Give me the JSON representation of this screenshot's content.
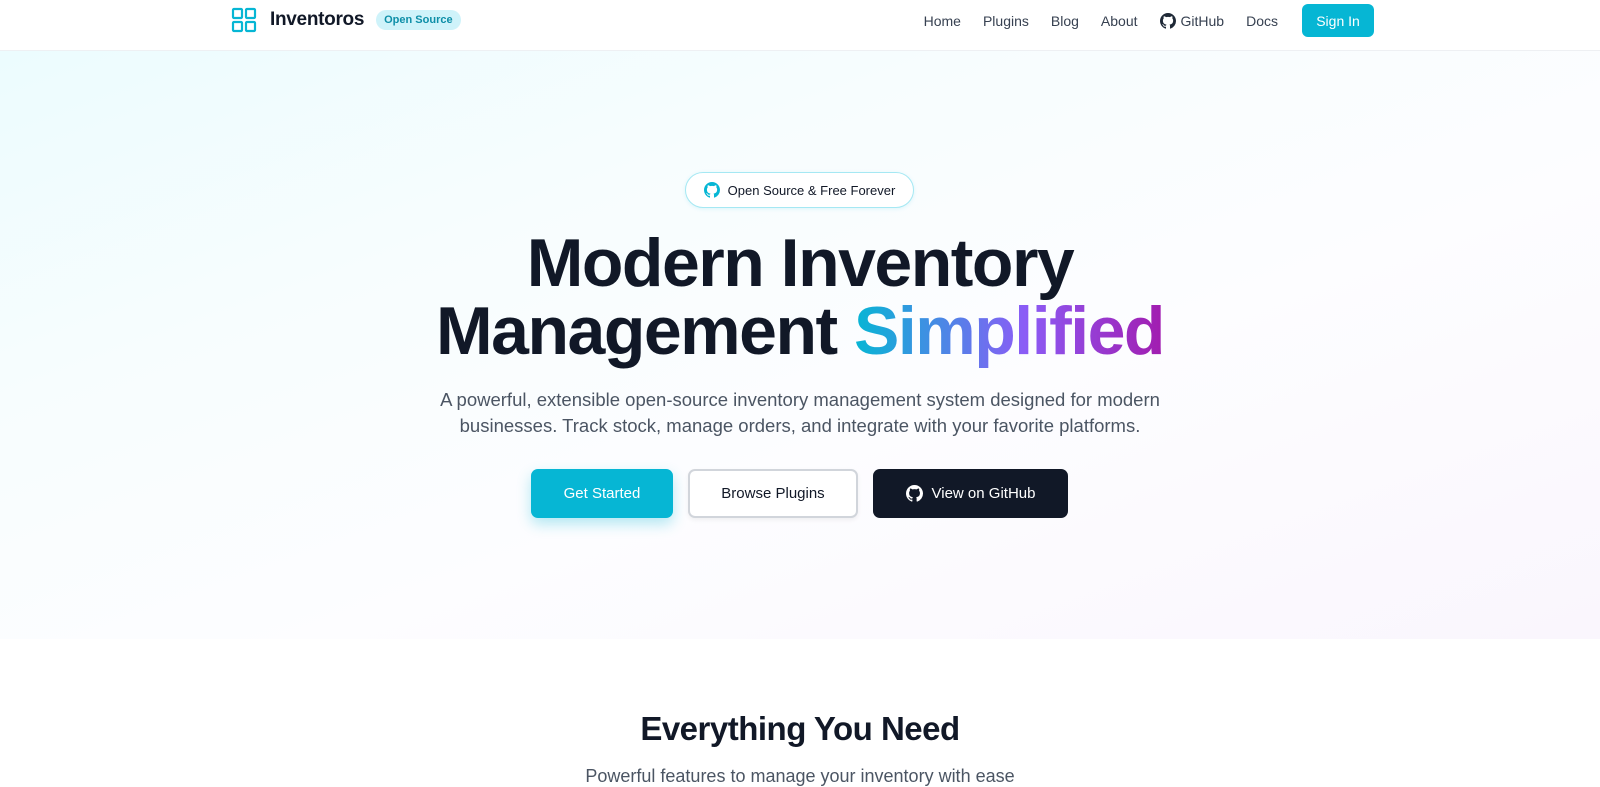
{
  "header": {
    "brand_name": "Inventoros",
    "badge": "Open Source",
    "logo_icon": "grid-icon",
    "nav": {
      "home": "Home",
      "plugins": "Plugins",
      "blog": "Blog",
      "about": "About",
      "github": "GitHub",
      "docs": "Docs"
    },
    "sign_in": "Sign In"
  },
  "hero": {
    "pill_text": "Open Source & Free Forever",
    "title_line1": "Modern Inventory",
    "title_line2_plain": "Management",
    "title_line2_highlight": "Simplified",
    "subtitle_line1": "A powerful, extensible open-source inventory management system designed for modern",
    "subtitle_line2": "businesses. Track stock, manage orders, and integrate with your favorite platforms.",
    "buttons": {
      "get_started": "Get Started",
      "browse_plugins": "Browse Plugins",
      "view_github": "View on GitHub"
    }
  },
  "features": {
    "title": "Everything You Need",
    "subtitle": "Powerful features to manage your inventory with ease"
  },
  "colors": {
    "accent": "#06b6d4",
    "dark": "#111827",
    "gradient_end": "#a21caf"
  }
}
